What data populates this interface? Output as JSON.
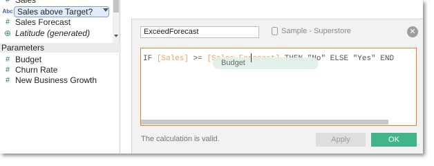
{
  "fields": [
    {
      "label": "Sales",
      "icon": "measure-icon",
      "style": "normal"
    },
    {
      "label": "Sales above Target?",
      "icon": "string-icon",
      "style": "selected"
    },
    {
      "label": "Sales Forecast",
      "icon": "measure-icon",
      "style": "normal"
    },
    {
      "label": "Latitude (generated)",
      "icon": "geo-icon",
      "style": "italic"
    }
  ],
  "parameters": {
    "header": "Parameters",
    "items": [
      {
        "label": "Budget"
      },
      {
        "label": "Churn Rate"
      },
      {
        "label": "New Business Growth"
      }
    ]
  },
  "dialog": {
    "calc_name": "ExceedForecast",
    "source": "Sample - Superstore",
    "formula": {
      "t1": "IF ",
      "f1": "[Sales]",
      "t2": " >= ",
      "f2": "[Sales Forecast]",
      "t3": " THEN \"No\" ELSE \"Yes\" END"
    },
    "autocomplete": "Budget",
    "status": "The calculation is valid.",
    "apply_label": "Apply",
    "ok_label": "OK"
  },
  "colors": {
    "accent_orange": "#e87d2f",
    "ok_green": "#41b58a",
    "field_ref": "#e3a36c"
  }
}
